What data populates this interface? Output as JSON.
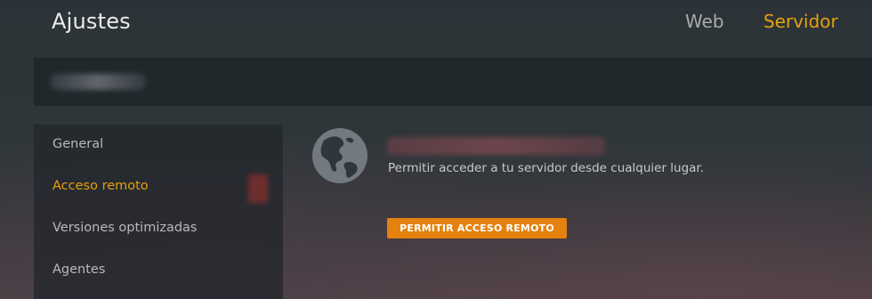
{
  "header": {
    "title": "Ajustes",
    "tabs": [
      {
        "label": "Web",
        "active": false
      },
      {
        "label": "Servidor",
        "active": true
      }
    ]
  },
  "sidebar": {
    "items": [
      {
        "label": "General",
        "active": false
      },
      {
        "label": "Acceso remoto",
        "active": true
      },
      {
        "label": "Versiones optimizadas",
        "active": false
      },
      {
        "label": "Agentes",
        "active": false
      }
    ]
  },
  "main": {
    "icon": "globe-icon",
    "description": "Permitir acceder a tu servidor desde cualquier lugar.",
    "button_label": "PERMITIR ACCESO REMOTO"
  },
  "colors": {
    "accent": "#e5a00d",
    "button": "#e5810d",
    "inactive_tab": "#a9a9a9",
    "text": "#c8c8c8"
  }
}
